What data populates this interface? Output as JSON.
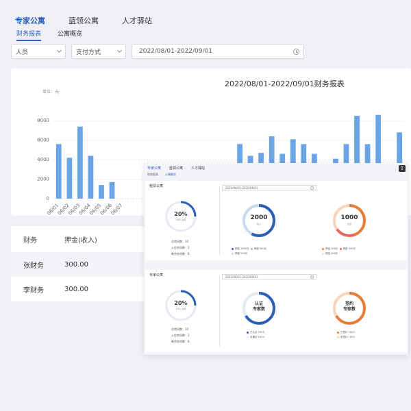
{
  "tabs": [
    "专家公寓",
    "蓝领公寓",
    "人才驿站"
  ],
  "subtabs": [
    "财务报表",
    "公寓概览"
  ],
  "filters": {
    "person": "人员",
    "payment": "支付方式",
    "date_range": "2022/08/01-2022/09/01"
  },
  "chart_data": {
    "type": "bar",
    "title": "2022/08/01-2022/09/01财务报表",
    "unit_label": "单位：元",
    "yticks": [
      "8000",
      "6000",
      "4000",
      "2000",
      "0"
    ],
    "ylim": [
      0,
      9000
    ],
    "categories_visible": [
      "06/01",
      "06/02",
      "06/03",
      "06/04",
      "06/05",
      "06/06",
      "06/07"
    ],
    "values": [
      5600,
      4200,
      7400,
      4400,
      1400,
      1700,
      0,
      0,
      0,
      0,
      0,
      0,
      0,
      0,
      0,
      0,
      0,
      5600,
      4400,
      4700,
      6400,
      4600,
      6100,
      5600,
      4600,
      3600,
      4100,
      5600,
      8500,
      5600,
      8600,
      1200,
      6800
    ],
    "color": "#6aa5e6"
  },
  "table": {
    "headers": [
      "财务",
      "押金(收入)"
    ],
    "rows": [
      [
        "张财务",
        "300.00"
      ],
      [
        "李财务",
        "300.00"
      ]
    ]
  },
  "overlay": {
    "tabs": [
      "专家公寓",
      "蓝领公寓",
      "人才驿站"
    ],
    "subtabs": [
      "财务报表",
      "公寓概览"
    ],
    "card1": {
      "title": "租赁公寓",
      "date": "2022/08/01-2022/09/01",
      "ring_pct": "20%",
      "ring_sub": "平均入住率",
      "stats": [
        "总房间数：10",
        "入住房间数：2",
        "剩余房间数：8"
      ],
      "ring2_value": "2000",
      "ring2_sub": "收入",
      "ring3_value": "1000",
      "ring3_sub": "支出",
      "legend2": [
        "押金 1000元",
        "房租 500元",
        "押金 500元"
      ],
      "legend3": [
        "押金 200元",
        "房费 300元",
        "押金 500元"
      ]
    },
    "card2": {
      "title": "专家公寓",
      "date": "2022/08/01-2022/09/01",
      "ring_pct": "20%",
      "ring_sub": "平均入住率",
      "stats": [
        "总房间数：10",
        "入住房间数：2",
        "剩余房间数：8"
      ],
      "ring2_value": "认证\n专家数",
      "ring3_value": "签约\n专家数",
      "legend2": [
        "已认证 200人",
        "未通过 100人"
      ],
      "legend3": [
        "已签约 200人",
        "未签约 100人"
      ]
    }
  },
  "colors": {
    "primary": "#2d5fb8",
    "bar": "#6aa5e6",
    "orange": "#e67e3a"
  }
}
